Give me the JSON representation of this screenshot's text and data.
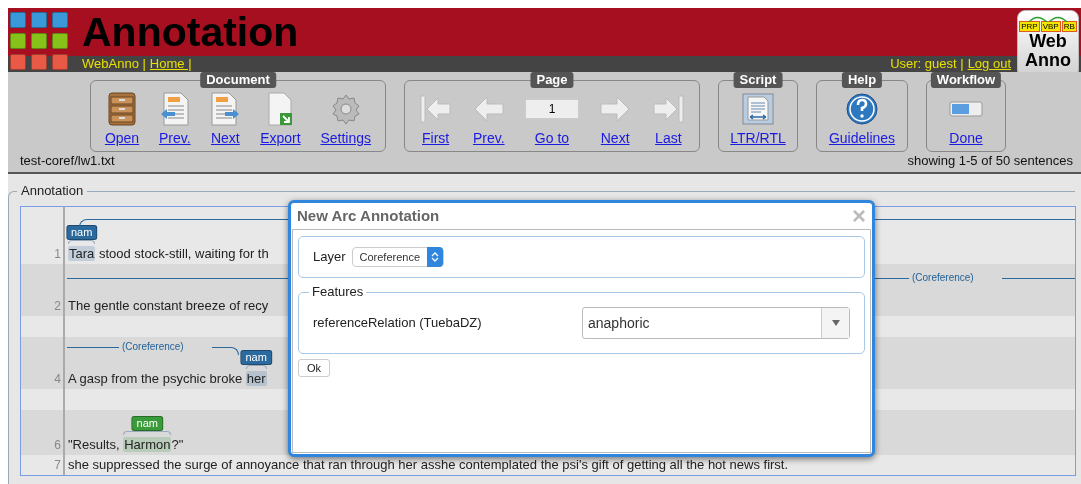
{
  "header": {
    "title": "Annotation",
    "brand": "WebAnno |",
    "home_link": "Home |",
    "user": "User: guest |",
    "logout": "Log out"
  },
  "logo": {
    "tags": [
      "PRP",
      "VBP",
      "RB"
    ],
    "lines": [
      "Web",
      "Anno"
    ]
  },
  "toolbar": [
    {
      "title": "Document",
      "buttons": [
        {
          "kind": "button",
          "label": "Open"
        },
        {
          "kind": "button",
          "label": "Prev."
        },
        {
          "kind": "button",
          "label": "Next"
        },
        {
          "kind": "button",
          "label": "Export"
        },
        {
          "kind": "button",
          "label": "Settings"
        }
      ]
    },
    {
      "title": "Page",
      "buttons": [
        {
          "kind": "button",
          "label": "First"
        },
        {
          "kind": "button",
          "label": "Prev."
        },
        {
          "kind": "field",
          "value": "1",
          "label": "Go to"
        },
        {
          "kind": "button",
          "label": "Next"
        },
        {
          "kind": "button",
          "label": "Last"
        }
      ]
    },
    {
      "title": "Script",
      "buttons": [
        {
          "kind": "button",
          "label": "LTR/RTL"
        }
      ]
    },
    {
      "title": "Help",
      "buttons": [
        {
          "kind": "button",
          "label": "Guidelines"
        }
      ]
    },
    {
      "title": "Workflow",
      "buttons": [
        {
          "kind": "button",
          "label": "Done"
        }
      ]
    }
  ],
  "file": "test-coref/lw1.txt",
  "sentence_count": "showing 1-5 of 50 sentences",
  "annotation": {
    "legend": "Annotation",
    "sentences": [
      {
        "number": "1",
        "arc": {
          "kind": "out"
        },
        "parts": [
          {
            "text": "Tara",
            "span": {
              "label": "nam",
              "color": "#2b6a9e"
            }
          },
          {
            "text": " stood stock-still, waiting for th"
          }
        ]
      },
      {
        "number": "2",
        "arc": {
          "kind": "through",
          "label": "(Coreference)"
        },
        "parts": [
          {
            "text": "The gentle constant breeze of recy"
          }
        ]
      },
      {
        "kind": "gap"
      },
      {
        "number": "4",
        "arc": {
          "kind": "in",
          "label": "(Coreference)"
        },
        "parts": [
          {
            "text": "A gasp from the psychic broke "
          },
          {
            "text": "her",
            "span": {
              "label": "nam",
              "color": "#2b6a9e"
            }
          }
        ]
      },
      {
        "kind": "gap"
      },
      {
        "number": "6",
        "parts": [
          {
            "text": "\"Results, "
          },
          {
            "text": "Harmon",
            "span": {
              "label": "nam",
              "color": "#3a9b3a"
            }
          },
          {
            "text": "?\""
          }
        ]
      },
      {
        "number": "7",
        "parts": [
          {
            "text": "she suppressed the surge of annoyance that ran through her asshe contemplated the psi's gift of getting all the hot news first."
          }
        ]
      }
    ]
  },
  "dialog": {
    "title": "New Arc Annotation",
    "close": "×",
    "layer_label": "Layer",
    "layer_value": "Coreference",
    "features_legend": "Features",
    "feature_label": "referenceRelation (TuebaDZ)",
    "feature_value": "anaphoric",
    "ok": "Ok"
  }
}
